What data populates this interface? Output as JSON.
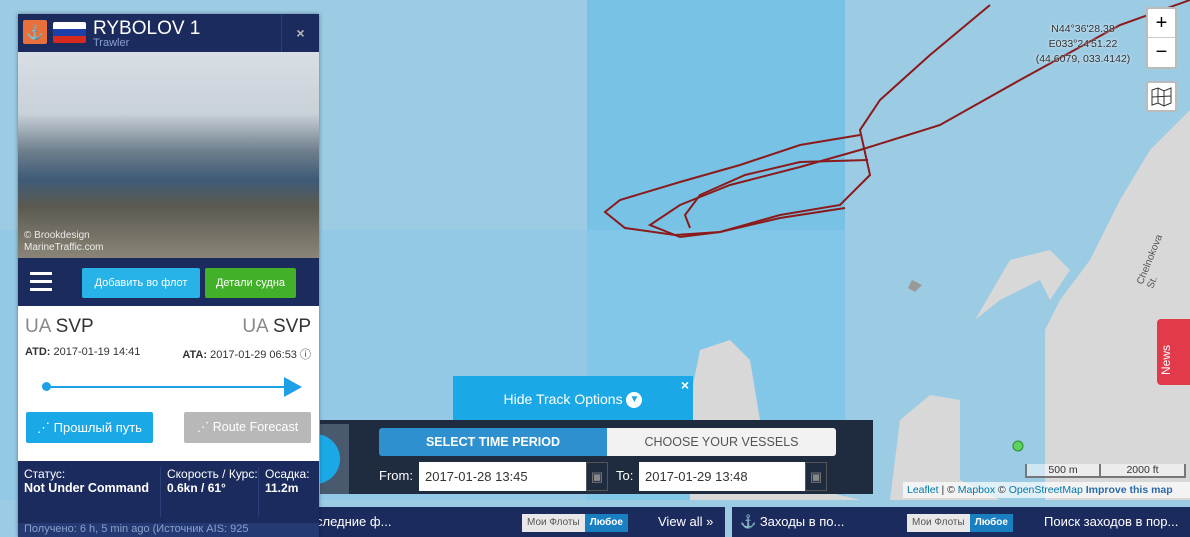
{
  "vessel": {
    "name": "RYBOLOV 1",
    "type": "Trawler",
    "photo_credit": "© Brookdesign\nMarineTraffic.com",
    "close": "×",
    "add_fleet": "Добавить во флот",
    "details": "Детали судна",
    "from_country": "UA",
    "from_port": "SVP",
    "to_country": "UA",
    "to_port": "SVP",
    "atd_label": "ATD:",
    "atd": "2017-01-19 14:41",
    "ata_label": "ATA:",
    "ata": "2017-01-29 06:53",
    "past_track": "Прошлый путь",
    "route_forecast": "Route Forecast",
    "status_label": "Статус:",
    "status": "Not Under Command",
    "speed_label": "Скорость / Курс:",
    "speed": "0.6kn / 61°",
    "draught_label": "Осадка:",
    "draught": "11.2m",
    "received": "Получено: 6 h, 5 min ago (Источник AIS: 925"
  },
  "map": {
    "coord_dms_lat": "N44°36'28.38",
    "coord_dms_lon": "E033°24'51.22",
    "coord_dec": "(44.6079, 033.4142)",
    "zoom_in": "+",
    "zoom_out": "−",
    "street": "Chelnokova St.",
    "scale_m": "500 m",
    "scale_ft": "2000 ft",
    "attr_leaflet": "Leaflet",
    "attr_mapbox": "Mapbox",
    "attr_osm": "OpenStreetMap",
    "attr_improve": "Improve this map",
    "news": "News",
    "track_color": "#8b1a1a"
  },
  "track": {
    "hide": "Hide Track Options",
    "tab_time": "SELECT TIME PERIOD",
    "tab_vessels": "CHOOSE YOUR VESSELS",
    "from_label": "From:",
    "from": "2017-01-28 13:45",
    "to_label": "To:",
    "to": "2017-01-29 13:48"
  },
  "bottom": {
    "recent": "следние ф...",
    "my_fleets": "Мои Флоты",
    "any": "Любое",
    "view_all": "View all »",
    "port_calls": "Заходы в по...",
    "my_fleets2": "Мои Флоты",
    "any2": "Любое",
    "search_calls": "Поиск заходов в пор..."
  }
}
